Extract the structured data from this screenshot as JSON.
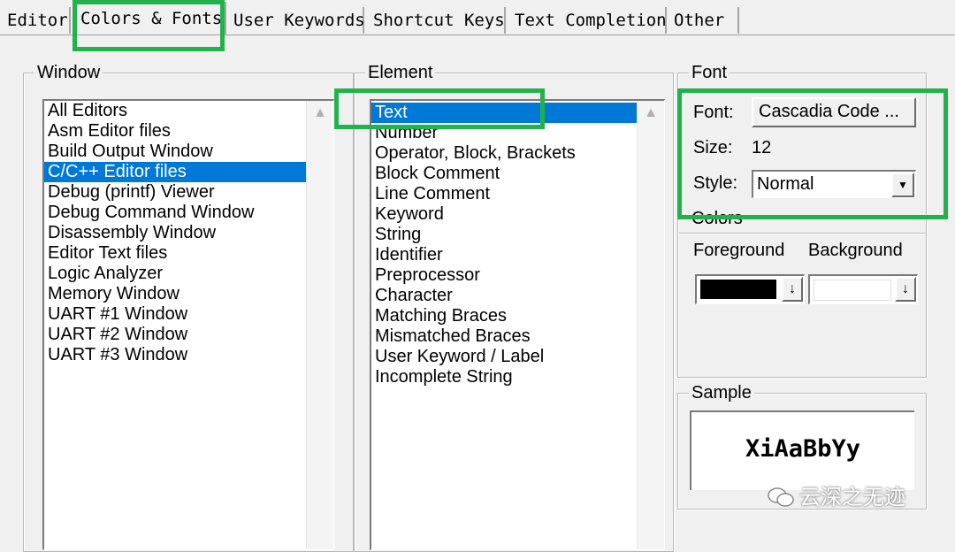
{
  "tabs": [
    {
      "label": "Editor",
      "active": false
    },
    {
      "label": "Colors & Fonts",
      "active": true
    },
    {
      "label": "User Keywords",
      "active": false
    },
    {
      "label": "Shortcut Keys",
      "active": false
    },
    {
      "label": "Text Completion",
      "active": false
    },
    {
      "label": "Other",
      "active": false
    }
  ],
  "window_group": {
    "label": "Window",
    "items": [
      "All Editors",
      "Asm Editor files",
      "Build Output Window",
      "C/C++ Editor files",
      "Debug (printf) Viewer",
      "Debug Command Window",
      "Disassembly Window",
      "Editor Text files",
      "Logic Analyzer",
      "Memory Window",
      "UART #1 Window",
      "UART #2 Window",
      "UART #3 Window"
    ],
    "selected_index": 3
  },
  "element_group": {
    "label": "Element",
    "items": [
      "Text",
      "Number",
      "Operator, Block, Brackets",
      "Block Comment",
      "Line Comment",
      "Keyword",
      "String",
      "Identifier",
      "Preprocessor",
      "Character",
      "Matching Braces",
      "Mismatched Braces",
      "User Keyword / Label",
      "Incomplete String"
    ],
    "selected_index": 0
  },
  "font_group": {
    "label": "Font",
    "font_label": "Font:",
    "font_button": "Cascadia Code ...",
    "size_label": "Size:",
    "size_value": "12",
    "style_label": "Style:",
    "style_value": "Normal"
  },
  "colors_group": {
    "label": "Colors",
    "foreground_label": "Foreground",
    "background_label": "Background",
    "foreground_color": "#000000",
    "background_color": "#ffffff"
  },
  "sample_group": {
    "label": "Sample",
    "text": "XiAaBbYy"
  },
  "watermark": "云深之无迹",
  "highlight_color": "#22b14c"
}
